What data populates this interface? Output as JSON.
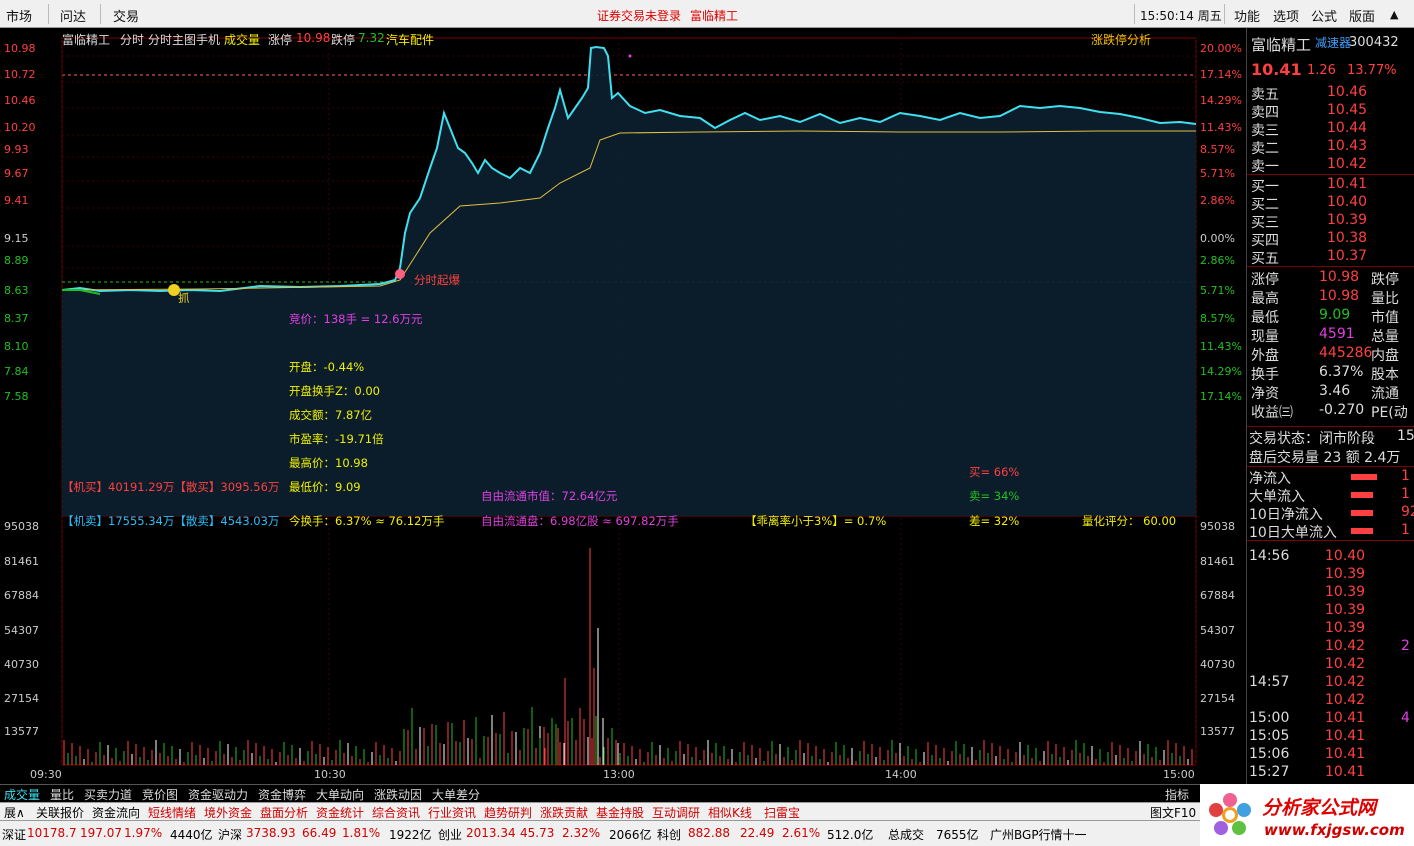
{
  "menubar": {
    "items": [
      "市场",
      "问达",
      "交易"
    ],
    "alert": "证券交易未登录",
    "stock_name": "富临精工",
    "clock": "15:50:14 周五",
    "right_items": [
      "功能",
      "选项",
      "公式",
      "版面"
    ]
  },
  "header": {
    "name": "富临精工",
    "mode1": "分时",
    "mode2": "分时主图手机",
    "vol_label": "成交量",
    "zt_label": "涨停",
    "zt_val": "10.98",
    "dt_label": "跌停",
    "dt_val": "7.32",
    "sector": "汽车配件",
    "analysis": "涨跌停分析"
  },
  "axis": {
    "price_left": [
      "10.98",
      "10.72",
      "10.46",
      "10.20",
      "9.93",
      "9.67",
      "9.41",
      "9.15",
      "8.89",
      "8.63",
      "8.37",
      "8.10",
      "7.84",
      "7.58"
    ],
    "pct_right": [
      "20.00%",
      "17.14%",
      "14.29%",
      "11.43%",
      "8.57%",
      "5.71%",
      "2.86%",
      "0.00%",
      "2.86%",
      "5.71%",
      "8.57%",
      "11.43%",
      "14.29%",
      "17.14%"
    ],
    "vol_left": [
      "95038",
      "81461",
      "67884",
      "54307",
      "40730",
      "27154",
      "13577"
    ],
    "time": [
      "09:30",
      "10:30",
      "13:00",
      "14:00",
      "15:00"
    ]
  },
  "annotations": {
    "bid": "竞价：138手 = 12.6万元",
    "open": "开盘：-0.44%",
    "open_turn": "开盘换手Z：0.00",
    "amount": "成交额：7.87亿",
    "pe": "市盈率：-19.71倍",
    "high": "最高价：10.98",
    "low": "最低价：9.09",
    "turnover": "今换手：6.37% ≈ 76.12万手",
    "jm_buy": "【机买】40191.29万【散买】3095.56万",
    "jm_sell": "【机卖】17555.34万【散卖】4543.03万",
    "float_mv": "自由流通市值：72.64亿元",
    "float_shares": "自由流通盘：6.98亿股 ≈ 697.82万手",
    "deviation": "【乖离率小于3%】= 0.7%",
    "buy_pct": "买= 66%",
    "sell_pct": "卖= 34%",
    "diff_pct": "差= 32%",
    "score": "量化评分：  60.00",
    "marker1": "分时起爆",
    "marker2": "抓"
  },
  "panel": {
    "name": "富临精工",
    "tag": "减速器",
    "code": "300432",
    "price": "10.41",
    "chg": "1.26",
    "chg_pct": "13.77%",
    "asks": [
      [
        "卖五",
        "10.46"
      ],
      [
        "卖四",
        "10.45"
      ],
      [
        "卖三",
        "10.44"
      ],
      [
        "卖二",
        "10.43"
      ],
      [
        "卖一",
        "10.42"
      ]
    ],
    "bids": [
      [
        "买一",
        "10.41"
      ],
      [
        "买二",
        "10.40"
      ],
      [
        "买三",
        "10.39"
      ],
      [
        "买四",
        "10.38"
      ],
      [
        "买五",
        "10.37"
      ]
    ],
    "stats": [
      [
        "涨停",
        "10.98",
        "跌停"
      ],
      [
        "最高",
        "10.98",
        "量比"
      ],
      [
        "最低",
        "9.09",
        "市值"
      ],
      [
        "现量",
        "4591",
        "总量"
      ],
      [
        "外盘",
        "445286",
        "内盘"
      ],
      [
        "换手",
        "6.37%",
        "股本"
      ],
      [
        "净资",
        "3.46",
        "流通"
      ],
      [
        "收益㈢",
        "-0.270",
        "PE(动"
      ]
    ],
    "trade_state": "交易状态：闭市阶段",
    "trade_state_val": "15",
    "after_hours": "盘后交易量 23  额 2.4万",
    "flows": [
      "净流入",
      "大单流入",
      "10日净流入",
      "10日大单流入"
    ],
    "flow_vals": [
      "1",
      "1",
      "92",
      "1"
    ],
    "ticks": [
      [
        "14:56",
        "10.40"
      ],
      [
        "",
        "10.39"
      ],
      [
        "",
        "10.39"
      ],
      [
        "",
        "10.39"
      ],
      [
        "",
        "10.39"
      ],
      [
        "",
        "10.42"
      ],
      [
        "",
        "10.42"
      ],
      [
        "14:57",
        "10.42"
      ],
      [
        "",
        "10.42"
      ],
      [
        "15:00",
        "10.41"
      ],
      [
        "15:05",
        "10.41"
      ],
      [
        "15:06",
        "10.41"
      ],
      [
        "15:27",
        "10.41"
      ]
    ],
    "tick_side": [
      "",
      "",
      "",
      "",
      "",
      "2",
      "",
      "",
      "",
      "4",
      "",
      "",
      ""
    ]
  },
  "tabs1": [
    "成交量",
    "量比",
    "买卖力道",
    "竞价图",
    "资金驱动力",
    "资金博弈",
    "大单动向",
    "涨跌动因",
    "大单差分"
  ],
  "tabs1_right": "指标",
  "tabs2": [
    "展∧",
    "关联报价",
    "资金流向",
    "短线情绪",
    "境外资金",
    "盘面分析",
    "资金统计",
    "综合资讯",
    "行业资讯",
    "趋势研判",
    "涨跌贡献",
    "基金持股",
    "互动调研",
    "相似K线",
    "扫雷宝"
  ],
  "tabs2_right": "图文F10",
  "status": {
    "sz": "深证",
    "sz_idx": "10178.7",
    "sz_chg": "197.07",
    "sz_pct": "1.97%",
    "sz_amt": "4440亿",
    "hs": "沪深",
    "hs_idx": "3738.93",
    "hs_chg": "66.49",
    "hs_pct": "1.81%",
    "hs_amt": "1922亿",
    "cy": "创业",
    "cy_idx": "2013.34",
    "cy_chg": "45.73",
    "cy_pct": "2.32%",
    "cy_amt": "2066亿",
    "kc": "科创",
    "kc_idx": "882.88",
    "kc_chg": "22.49",
    "kc_pct": "2.61%",
    "kc_amt": "512.0亿",
    "total_label": "总成交",
    "total": "7655亿",
    "server": "广州BGP行情十一"
  },
  "logo": {
    "title": "分析家公式网",
    "url": "www.fxjgsw.com"
  },
  "watermark": "分析家公式网www.fxjgsw.com",
  "chart_data": {
    "type": "line",
    "x": [
      "09:30",
      "10:00",
      "10:30",
      "11:00",
      "11:30",
      "13:00",
      "13:30",
      "14:00",
      "14:30",
      "15:00"
    ],
    "series": [],
    "price_ylim": [
      7.32,
      10.98
    ],
    "prev_close": 9.15
  },
  "colors": {
    "up": "#ff4040",
    "down": "#20c020",
    "price_line": "#40e0f0",
    "avg_line": "#e0c040",
    "yellow": "#f0f000",
    "magenta": "#e040e0"
  }
}
